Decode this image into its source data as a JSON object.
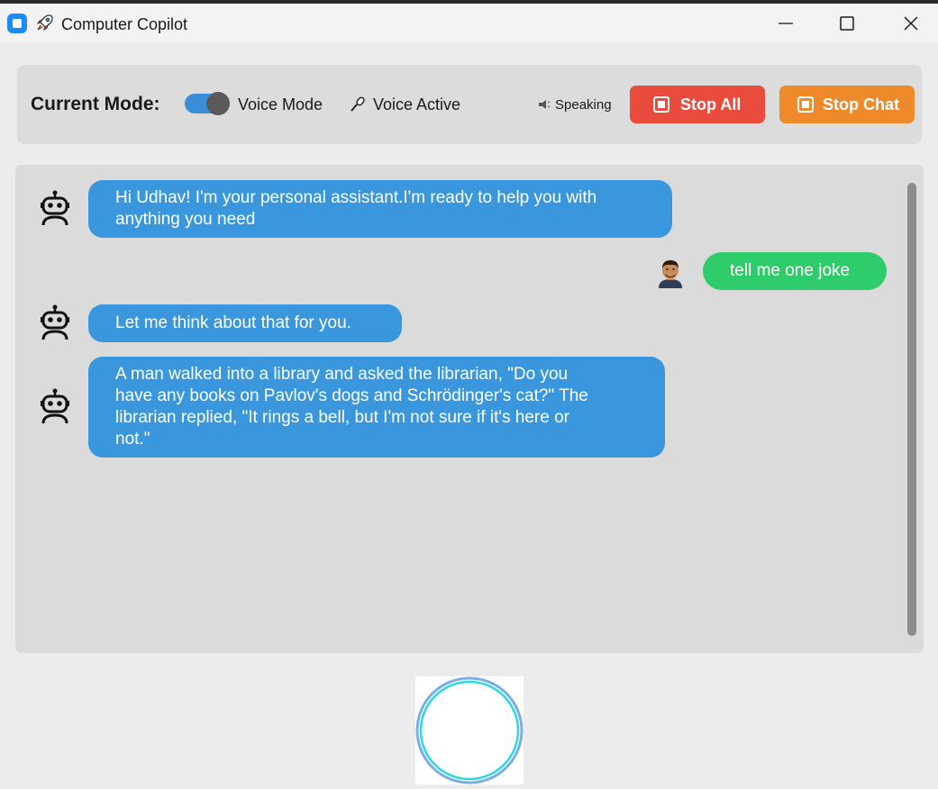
{
  "window": {
    "title": "Computer Copilot"
  },
  "mode_panel": {
    "label": "Current Mode:",
    "toggle_label": "Voice Mode",
    "toggle_on": true,
    "voice_status": "Voice Active",
    "speaking_status": "Speaking",
    "stop_all_label": "Stop All",
    "stop_chat_label": "Stop Chat"
  },
  "chat": {
    "messages": [
      {
        "sender": "bot",
        "lines": [
          "Hi Udhav! I'm your personal assistant.I'm ready to help you with",
          "anything you need"
        ]
      },
      {
        "sender": "user",
        "lines": [
          "tell me one joke"
        ]
      },
      {
        "sender": "bot",
        "lines": [
          "Let me think about that for you."
        ]
      },
      {
        "sender": "bot",
        "lines": [
          "A man walked into a library and asked the librarian, \"Do you",
          "have any books on Pavlov's dogs and Schrödinger's cat?\" The",
          "librarian replied, \"It rings a bell, but I'm not sure if it's here or",
          "not.\""
        ]
      }
    ]
  },
  "colors": {
    "bot_bubble": "#3a97dd",
    "user_bubble": "#2ecc6a",
    "stop_all": "#e94b3c",
    "stop_chat": "#ee8a2a",
    "toggle": "#3a8ed8"
  },
  "icons": {
    "app": "app-icon",
    "rocket": "rocket-icon",
    "mic": "microphone-icon",
    "speaker": "speaker-icon",
    "bot": "robot-icon",
    "user": "user-avatar-icon",
    "orb": "voice-orb"
  }
}
